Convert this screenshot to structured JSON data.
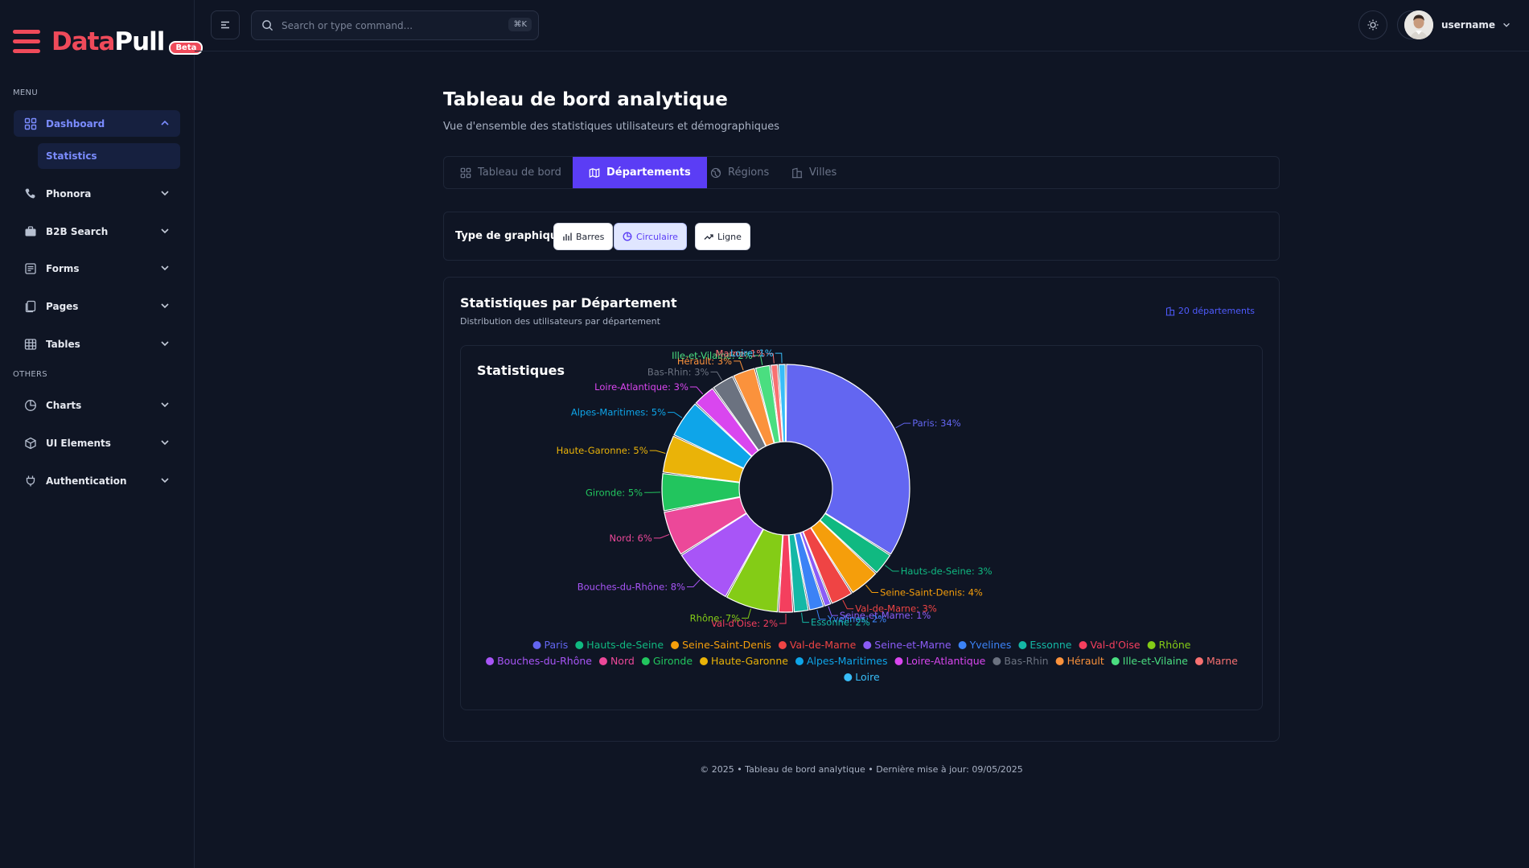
{
  "brand": {
    "part1": "Data",
    "part2": "Pull",
    "badge": "Beta"
  },
  "sidebar": {
    "menu_label": "MENU",
    "others_label": "OTHERS",
    "items": [
      {
        "label": "Dashboard",
        "icon": "grid-icon"
      },
      {
        "label": "Phonora",
        "icon": "phone-icon"
      },
      {
        "label": "B2B Search",
        "icon": "briefcase-icon"
      },
      {
        "label": "Forms",
        "icon": "form-icon"
      },
      {
        "label": "Pages",
        "icon": "pages-icon"
      },
      {
        "label": "Tables",
        "icon": "table-icon"
      }
    ],
    "sub_item": "Statistics",
    "others": [
      {
        "label": "Charts",
        "icon": "pie-chart-icon"
      },
      {
        "label": "UI Elements",
        "icon": "box-icon"
      },
      {
        "label": "Authentication",
        "icon": "plug-icon"
      }
    ]
  },
  "topbar": {
    "search_placeholder": "Search or type command...",
    "shortcut": "⌘K",
    "username": "username"
  },
  "page": {
    "title": "Tableau de bord analytique",
    "subtitle": "Vue d'ensemble des statistiques utilisateurs et démographiques"
  },
  "tabs": [
    {
      "label": "Tableau de bord",
      "icon": "grid-icon",
      "active": false
    },
    {
      "label": "Départements",
      "icon": "map-icon",
      "active": true
    },
    {
      "label": "Régions",
      "icon": "globe-icon",
      "active": false
    },
    {
      "label": "Villes",
      "icon": "building-icon",
      "active": false
    }
  ],
  "chart_type": {
    "label": "Type de graphique:",
    "options": [
      {
        "label": "Barres",
        "icon": "bar-chart-icon",
        "active": false
      },
      {
        "label": "Circulaire",
        "icon": "pie-icon",
        "active": true
      },
      {
        "label": "Ligne",
        "icon": "trend-icon",
        "active": false
      }
    ]
  },
  "stats": {
    "title": "Statistiques par Département",
    "subtitle": "Distribution des utilisateurs par département",
    "count": "20 départements",
    "inner_title": "Statistiques"
  },
  "chart_data": {
    "type": "pie",
    "donut": true,
    "categories": [
      "Paris",
      "Hauts-de-Seine",
      "Seine-Saint-Denis",
      "Val-de-Marne",
      "Seine-et-Marne",
      "Yvelines",
      "Essonne",
      "Val-d'Oise",
      "Rhône",
      "Bouches-du-Rhône",
      "Nord",
      "Gironde",
      "Haute-Garonne",
      "Alpes-Maritimes",
      "Loire-Atlantique",
      "Bas-Rhin",
      "Hérault",
      "Ille-et-Vilaine",
      "Marne",
      "Loire"
    ],
    "values": [
      34,
      3,
      4,
      3,
      1,
      2,
      2,
      2,
      7,
      8,
      6,
      5,
      5,
      5,
      3,
      3,
      3,
      2,
      1,
      1
    ],
    "colors": [
      "#6366f1",
      "#10b981",
      "#f59e0b",
      "#ef4444",
      "#8b5cf6",
      "#3b82f6",
      "#14b8a6",
      "#f43f5e",
      "#84cc16",
      "#a855f7",
      "#ec4899",
      "#22c55e",
      "#eab308",
      "#0ea5e9",
      "#d946ef",
      "#6b7280",
      "#fb923c",
      "#4ade80",
      "#f87171",
      "#38bdf8"
    ],
    "legend_position": "bottom"
  },
  "footer": "© 2025 • Tableau de bord analytique • Dernière mise à jour: 09/05/2025"
}
